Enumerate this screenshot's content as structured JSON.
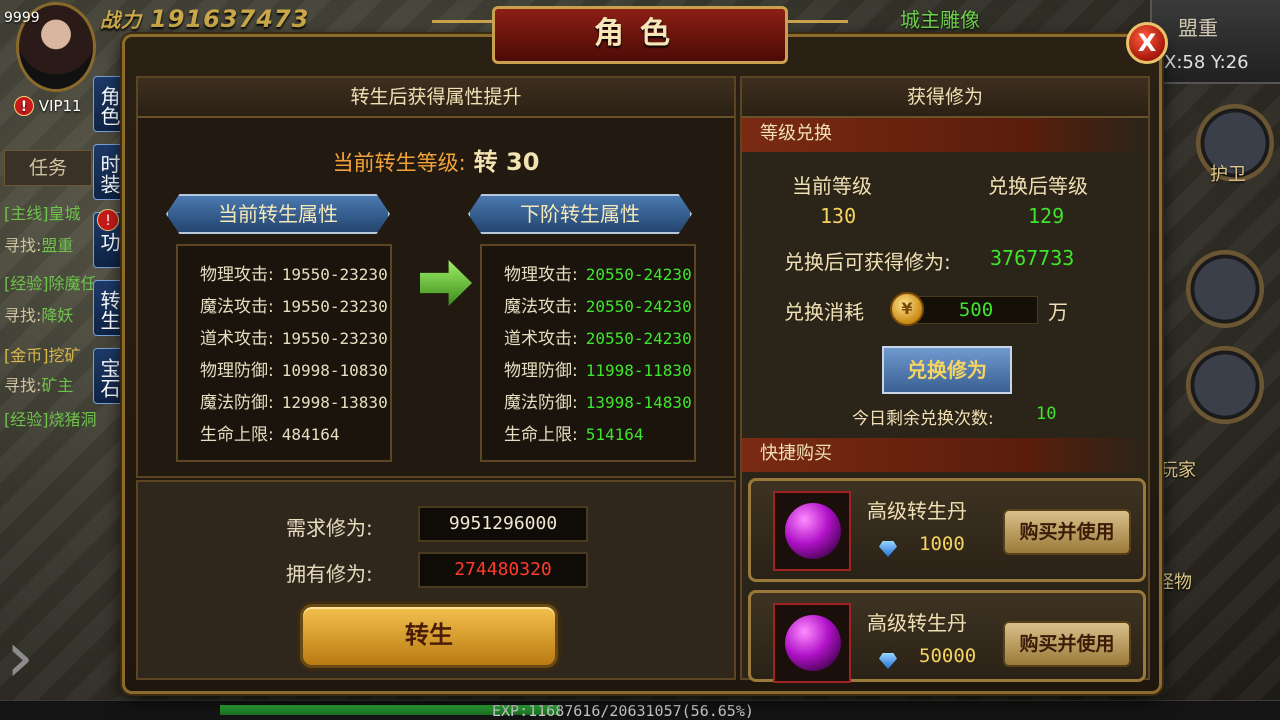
{
  "hud": {
    "level": "9999",
    "power_label": "战力",
    "power": "191637473",
    "vip": "VIP11",
    "map_name": "城主雕像",
    "minimap_name": "盟重",
    "coords": "X:58 Y:26",
    "quest_tab": "任务",
    "quests": [
      {
        "tag": "[主线]",
        "text": "皇城",
        "find": "寻找:",
        "target": "盟重"
      },
      {
        "tag": "[经验]",
        "text": "除魔任",
        "find": "寻找:",
        "target": "降妖"
      },
      {
        "tag": "[金币]",
        "text": "挖矿",
        "find": "寻找:",
        "target": "矿主"
      },
      {
        "tag": "[经验]",
        "text": "烧猪洞",
        "find": "",
        "target": ""
      }
    ],
    "side_tabs": [
      "角色",
      "时装",
      "功",
      "转生",
      "宝石"
    ],
    "right_labels": [
      "护卫",
      "玩家",
      "怪物"
    ],
    "exp_text": "EXP:11687616/20631057(56.65%)",
    "exp_percent": 56.65
  },
  "dialog": {
    "title": "角色",
    "close": "X"
  },
  "left": {
    "header": "转生后获得属性提升",
    "current_level_label": "当前转生等级:",
    "current_level_value": "转 30",
    "current_ribbon": "当前转生属性",
    "next_ribbon": "下阶转生属性",
    "current_attrs": [
      {
        "label": "物理攻击:",
        "value": "19550-23230"
      },
      {
        "label": "魔法攻击:",
        "value": "19550-23230"
      },
      {
        "label": "道术攻击:",
        "value": "19550-23230"
      },
      {
        "label": "物理防御:",
        "value": "10998-10830"
      },
      {
        "label": "魔法防御:",
        "value": "12998-13830"
      },
      {
        "label": "生命上限:",
        "value": "484164"
      }
    ],
    "next_attrs": [
      {
        "label": "物理攻击:",
        "value": "20550-24230"
      },
      {
        "label": "魔法攻击:",
        "value": "20550-24230"
      },
      {
        "label": "道术攻击:",
        "value": "20550-24230"
      },
      {
        "label": "物理防御:",
        "value": "11998-11830"
      },
      {
        "label": "魔法防御:",
        "value": "13998-14830"
      },
      {
        "label": "生命上限:",
        "value": "514164"
      }
    ],
    "required_label": "需求修为:",
    "required_value": "9951296000",
    "owned_label": "拥有修为:",
    "owned_value": "274480320",
    "rebirth_button": "转生"
  },
  "right": {
    "header": "获得修为",
    "exchange_section": "等级兑换",
    "current_level_label": "当前等级",
    "after_level_label": "兑换后等级",
    "current_level": "130",
    "after_level": "129",
    "gain_label": "兑换后可获得修为:",
    "gain_value": "3767733",
    "cost_label": "兑换消耗",
    "cost_value": "500",
    "cost_unit": "万",
    "exchange_button": "兑换修为",
    "remaining_label": "今日剩余兑换次数:",
    "remaining_value": "10",
    "shop_section": "快捷购买",
    "shop_items": [
      {
        "name": "高级转生丹",
        "price": "1000",
        "button": "购买并使用"
      },
      {
        "name": "高级转生丹",
        "price": "50000",
        "button": "购买并使用"
      }
    ]
  }
}
